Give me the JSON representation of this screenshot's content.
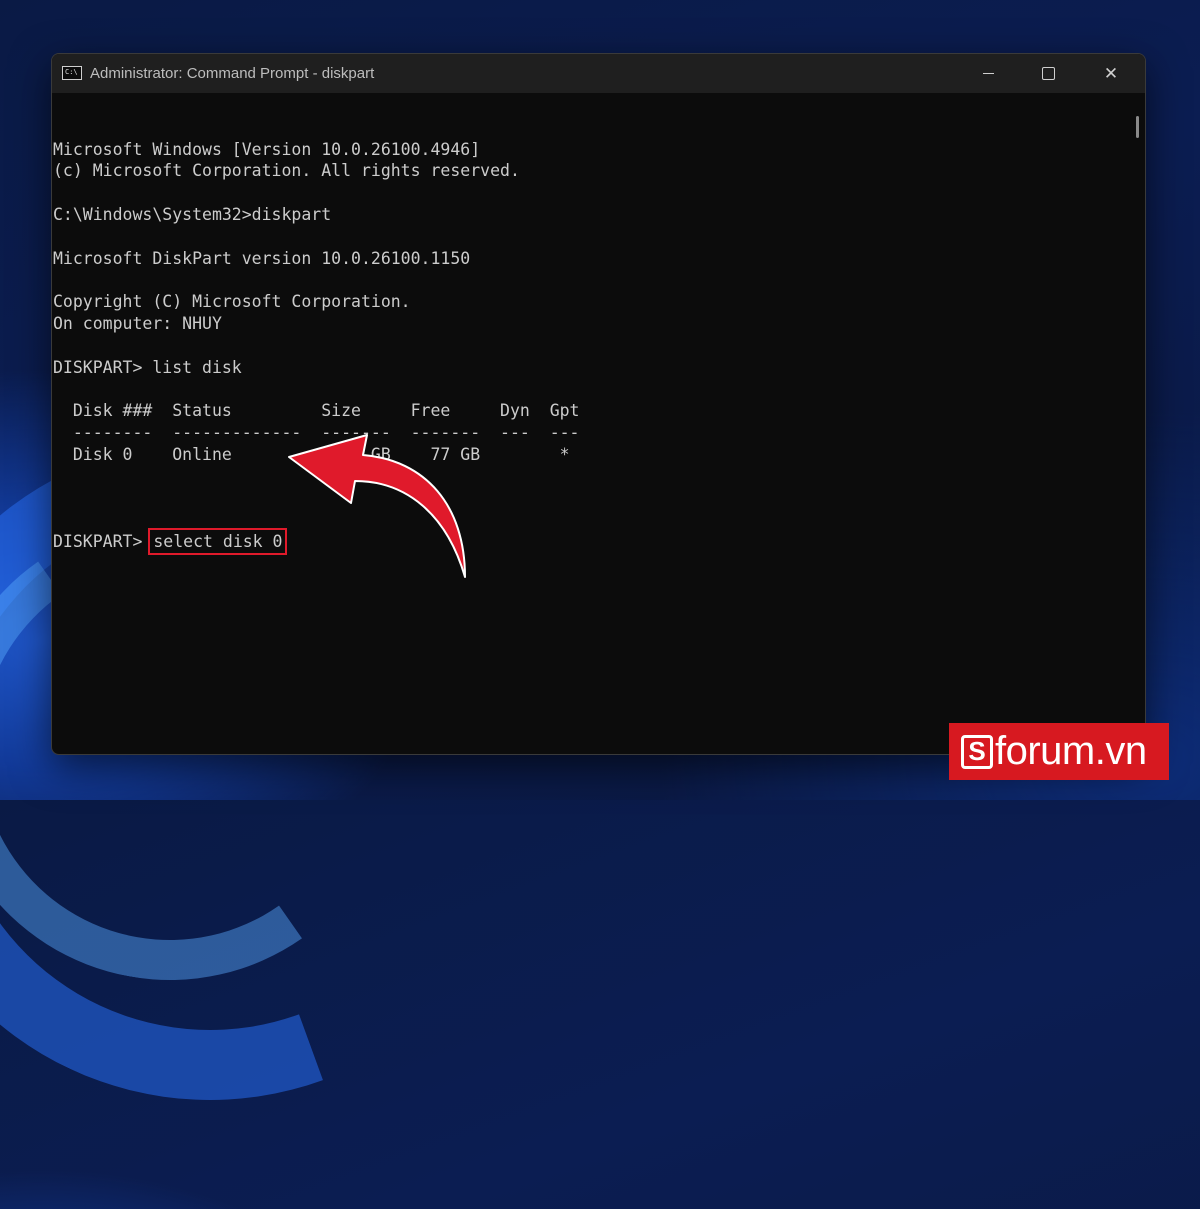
{
  "window": {
    "title": "Administrator: Command Prompt - diskpart",
    "icon": "cmd-icon",
    "controls": [
      "minimize-icon",
      "maximize-icon",
      "close-icon"
    ],
    "close_glyph": "✕"
  },
  "console": {
    "lines": [
      "Microsoft Windows [Version 10.0.26100.4946]",
      "(c) Microsoft Corporation. All rights reserved.",
      "",
      "C:\\Windows\\System32>diskpart",
      "",
      "Microsoft DiskPart version 10.0.26100.1150",
      "",
      "Copyright (C) Microsoft Corporation.",
      "On computer: NHUY",
      "",
      "DISKPART> list disk",
      "",
      "  Disk ###  Status         Size     Free     Dyn  Gpt",
      "  --------  -------------  -------  -------  ---  ---",
      "  Disk 0    Online          476 GB    77 GB        *",
      ""
    ],
    "prompt": "DISKPART> ",
    "highlighted_command": "select disk 0"
  },
  "annotation": {
    "highlight_color": "#e01a2b",
    "arrow_color": "#e01a2b"
  },
  "watermark": {
    "text": "forum.vn",
    "letter": "S",
    "color": "#d71920"
  }
}
